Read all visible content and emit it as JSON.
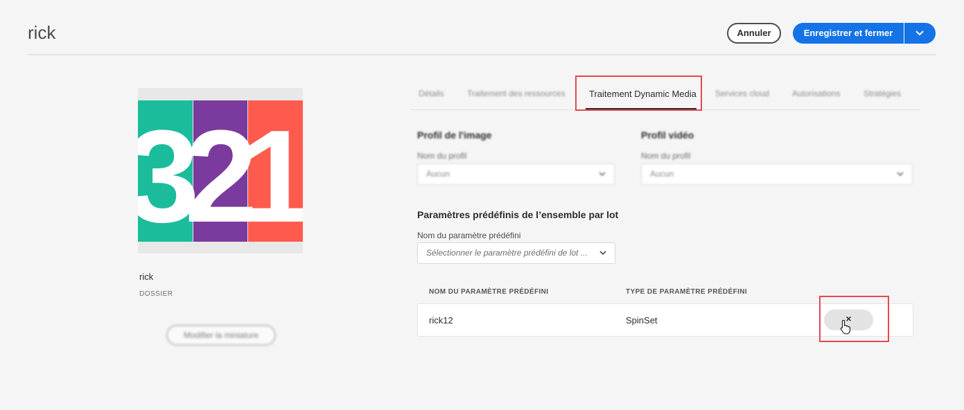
{
  "header": {
    "title": "rick",
    "cancel_label": "Annuler",
    "save_label": "Enregistrer et fermer",
    "more_icon": "chevron-down-icon"
  },
  "asset": {
    "name": "rick",
    "type": "DOSSIER",
    "edit_thumbnail_label": "Modifier la miniature",
    "thumbnail_colors": [
      "#1abc9c",
      "#7b3a9e",
      "#ff5a4e"
    ]
  },
  "tabs": [
    {
      "label": "Détails",
      "active": false
    },
    {
      "label": "Traitement des ressources",
      "active": false
    },
    {
      "label": "Traitement Dynamic Media",
      "active": true
    },
    {
      "label": "Services cloud",
      "active": false
    },
    {
      "label": "Autorisations",
      "active": false
    },
    {
      "label": "Stratégies",
      "active": false
    }
  ],
  "image_profile": {
    "title": "Profil de l'image",
    "field_label": "Nom du profil",
    "value": "Aucun"
  },
  "video_profile": {
    "title": "Profil vidéo",
    "field_label": "Nom du profil",
    "value": "Aucun"
  },
  "batch_set": {
    "title": "Paramètres prédéfinis de l’ensemble par lot",
    "field_label": "Nom du paramètre prédéfini",
    "placeholder": "Sélectionner le paramètre prédéfini de lot ...",
    "columns": [
      "NOM DU PARAMÈTRE PRÉDÉFINI",
      "TYPE DE PARAMÈTRE PRÉDÉFINI"
    ],
    "rows": [
      {
        "name": "rick12",
        "type": "SpinSet",
        "remove_label": "×"
      }
    ]
  },
  "colors": {
    "accent": "#1473e6",
    "highlight": "#e34850"
  }
}
